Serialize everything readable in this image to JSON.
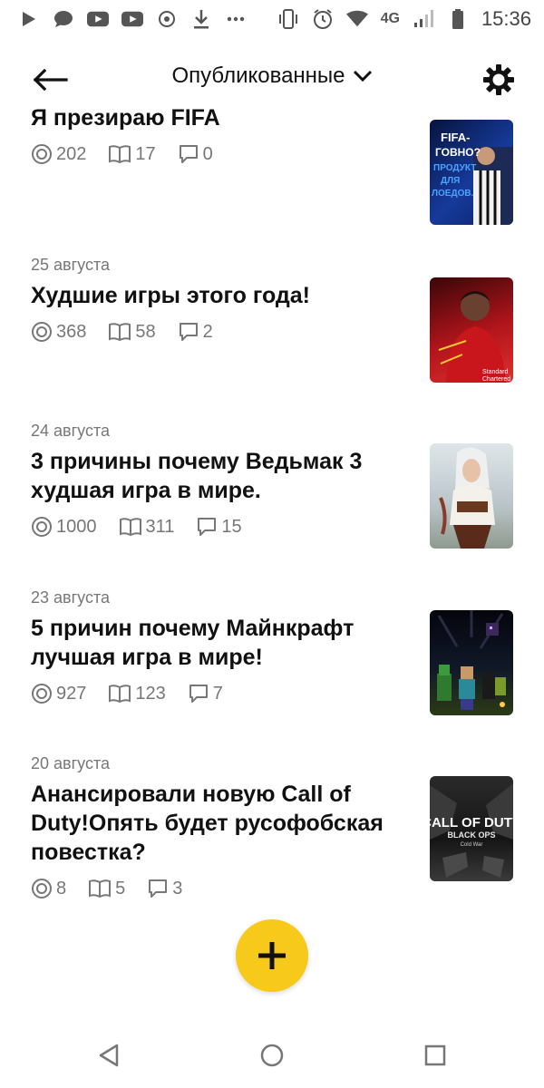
{
  "status_bar": {
    "network": "4G",
    "time": "15:36"
  },
  "header": {
    "title": "Опубликованные"
  },
  "articles": [
    {
      "date": "",
      "title": "Я презираю FIFA",
      "views": "202",
      "reads": "17",
      "comments": "0",
      "thumb_text": "FIFA- ГОВНО? ПРОДУКТ ДЛЯ ЛОЕДОВ.",
      "thumb_colors": [
        "#0b1a4d",
        "#1f3f9a"
      ]
    },
    {
      "date": "25 августа",
      "title": "Худшие игры этого года!",
      "views": "368",
      "reads": "58",
      "comments": "2",
      "thumb_text": "Standard Chartered",
      "thumb_colors": [
        "#7a0b10",
        "#d62727"
      ]
    },
    {
      "date": "24 августа",
      "title": "3 причины почему Ведьмак 3 худшая игра в мире.",
      "views": "1000",
      "reads": "311",
      "comments": "15",
      "thumb_text": "",
      "thumb_colors": [
        "#c9d3d8",
        "#7a4a3a"
      ]
    },
    {
      "date": "23 августа",
      "title": "5 причин почему Майнкрафт лучшая игра в мире!",
      "views": "927",
      "reads": "123",
      "comments": "7",
      "thumb_text": "",
      "thumb_colors": [
        "#0a0a16",
        "#3a5a1a"
      ]
    },
    {
      "date": "20 августа",
      "title": "Анансировали новую Call of Duty!Опять будет русофобская повестка?",
      "views": "8",
      "reads": "5",
      "comments": "3",
      "thumb_text": "CALL OF DUTY BLACK OPS Cold War",
      "thumb_colors": [
        "#1a1a1a",
        "#4a4a4a"
      ]
    }
  ],
  "fab": {
    "icon": "plus-icon",
    "color": "#f6c91a"
  },
  "colors": {
    "meta_text": "#777777",
    "accent": "#f6c91a"
  }
}
